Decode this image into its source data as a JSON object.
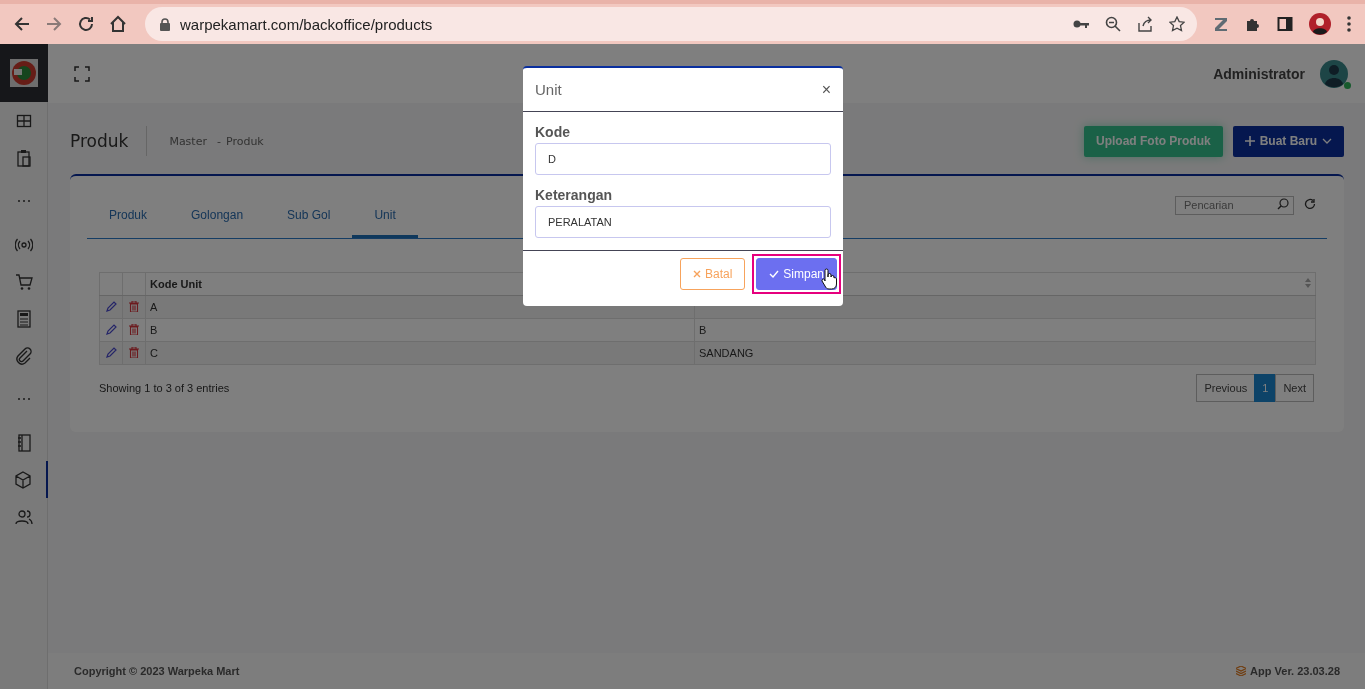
{
  "browser": {
    "url": "warpekamart.com/backoffice/products"
  },
  "sidebar": {
    "items": [
      {
        "kind": "grid",
        "selected": false
      },
      {
        "kind": "clipboard",
        "selected": false
      },
      {
        "kind": "dots",
        "selected": false
      },
      {
        "kind": "broadcast",
        "selected": false
      },
      {
        "kind": "cart",
        "selected": false
      },
      {
        "kind": "calculator",
        "selected": false
      },
      {
        "kind": "paperclip",
        "selected": false
      },
      {
        "kind": "dots",
        "selected": false
      },
      {
        "kind": "book",
        "selected": false
      },
      {
        "kind": "box",
        "selected": true
      },
      {
        "kind": "users",
        "selected": false
      }
    ]
  },
  "topbar": {
    "user": "Administrator"
  },
  "page": {
    "title": "Produk",
    "breadcrumb": [
      "Master",
      "Produk"
    ],
    "separator": "-"
  },
  "actions": [
    {
      "label": "Upload Foto Produk",
      "kind": "success"
    },
    {
      "label": "Buat Baru",
      "kind": "primary"
    }
  ],
  "tabs": [
    {
      "label": "Produk",
      "selected": false
    },
    {
      "label": "Golongan",
      "selected": false
    },
    {
      "label": "Sub Gol",
      "selected": false
    },
    {
      "label": "Unit",
      "selected": true
    }
  ],
  "search": {
    "placeholder": "Pencarian"
  },
  "table": {
    "columns": [
      "Kode Unit"
    ],
    "rows": [
      {
        "code": "A"
      },
      {
        "code": "B",
        "description": "B"
      },
      {
        "code": "C",
        "description": "SANDANG"
      }
    ]
  },
  "table_info": "Showing 1 to 3 of 3 entries",
  "pagination": [
    {
      "label": "Previous",
      "selected": false
    },
    {
      "label": "1",
      "selected": true
    },
    {
      "label": "Next",
      "selected": false
    }
  ],
  "footer": {
    "copyright": "Copyright © 2023 Warpeka Mart",
    "version": "App Ver. 23.03.28"
  },
  "modal": {
    "title": "Unit",
    "close": "×",
    "fields": [
      {
        "label": "Kode",
        "value": "D"
      },
      {
        "label": "Keterangan",
        "value": "PERALATAN"
      }
    ],
    "buttons": [
      {
        "label": "Batal",
        "kind": "cancel",
        "highlighted": false
      },
      {
        "label": "Simpan",
        "kind": "save",
        "highlighted": true
      }
    ]
  }
}
